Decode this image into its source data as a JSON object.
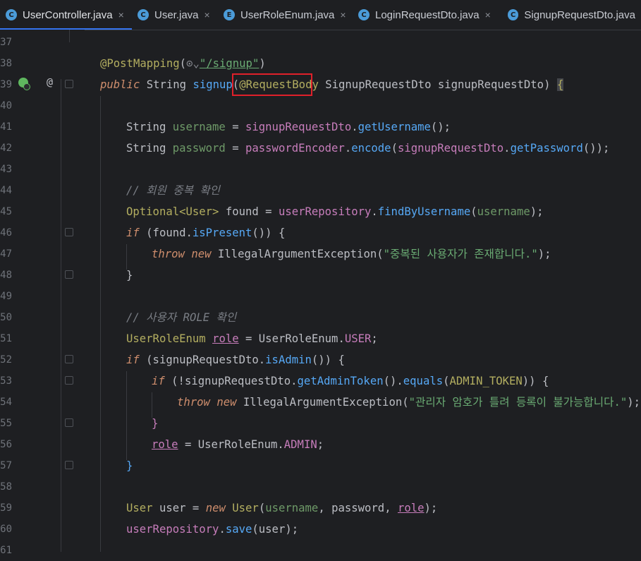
{
  "tabs": [
    {
      "label": "UserController.java",
      "icon": "class-icon",
      "active": true,
      "close": "×"
    },
    {
      "label": "User.java",
      "icon": "class-icon",
      "active": false,
      "close": "×"
    },
    {
      "label": "UserRoleEnum.java",
      "icon": "enum-icon",
      "active": false,
      "close": "×"
    },
    {
      "label": "LoginRequestDto.java",
      "icon": "class-icon",
      "active": false,
      "close": "×"
    },
    {
      "label": "SignupRequestDto.java",
      "icon": "class-icon",
      "active": false,
      "close": ""
    }
  ],
  "tab_icon_letters": {
    "class": "C",
    "enum": "E"
  },
  "line_numbers": [
    "37",
    "38",
    "39",
    "40",
    "41",
    "42",
    "43",
    "44",
    "45",
    "46",
    "47",
    "48",
    "49",
    "50",
    "51",
    "52",
    "53",
    "54",
    "55",
    "56",
    "57",
    "58",
    "59",
    "60",
    "61"
  ],
  "code": {
    "l38": {
      "a1": "@PostMapping",
      "a2": "(",
      "a3": "⊙⌄",
      "a4": "\"/signup\"",
      "a5": ")"
    },
    "l39": {
      "t1": "public",
      "t2": " String ",
      "t3": "signup",
      "t4": "(",
      "t5": "@RequestBody",
      "t6": " SignupRequestDto ",
      "t7": "signupRequestDto",
      "t8": ") ",
      "t9": "{"
    },
    "l41": {
      "t1": "String ",
      "t2": "username",
      "t3": " = ",
      "t4": "signupRequestDto",
      "t5": ".",
      "t6": "getUsername",
      "t7": "();"
    },
    "l42": {
      "t1": "String ",
      "t2": "password",
      "t3": " = ",
      "t4": "passwordEncoder",
      "t5": ".",
      "t6": "encode",
      "t7": "(",
      "t8": "signupRequestDto",
      "t9": ".",
      "t10": "getPassword",
      "t11": "());"
    },
    "l44": {
      "t1": "// 회원 중복 확인"
    },
    "l45": {
      "t1": "Optional<User> ",
      "t2": "found",
      "t3": " = ",
      "t4": "userRepository",
      "t5": ".",
      "t6": "findByUsername",
      "t7": "(",
      "t8": "username",
      "t9": ");"
    },
    "l46": {
      "t1": "if",
      "t2": " (found.",
      "t3": "isPresent",
      "t4": "()) {"
    },
    "l47": {
      "t1": "throw",
      "t2": " ",
      "t3": "new",
      "t4": " IllegalArgumentException",
      "t5": "(",
      "t6": "\"중복된 사용자가 존재합니다.\"",
      "t7": ");"
    },
    "l48": {
      "t1": "}"
    },
    "l50": {
      "t1": "// 사용자 ROLE 확인"
    },
    "l51": {
      "t1": "UserRoleEnum ",
      "t2": "role",
      "t3": " = UserRoleEnum.",
      "t4": "USER",
      "t5": ";"
    },
    "l52": {
      "t1": "if",
      "t2": " (signupRequestDto.",
      "t3": "isAdmin",
      "t4": "()) {"
    },
    "l53": {
      "t1": "if",
      "t2": " (!signupRequestDto.",
      "t3": "getAdminToken",
      "t4": "().",
      "t5": "equals",
      "t6": "(",
      "t7": "ADMIN_TOKEN",
      "t8": ")) {"
    },
    "l54": {
      "t1": "throw",
      "t2": " ",
      "t3": "new",
      "t4": " IllegalArgumentException",
      "t5": "(",
      "t6": "\"관리자 암호가 틀려 등록이 불가능합니다.\"",
      "t7": ");"
    },
    "l55": {
      "t1": "}"
    },
    "l56": {
      "t1": "role",
      "t2": " = UserRoleEnum.",
      "t3": "ADMIN",
      "t4": ";"
    },
    "l57": {
      "t1": "}"
    },
    "l59": {
      "t1": "User ",
      "t2": "user",
      "t3": " = ",
      "t4": "new",
      "t5": " User",
      "t6": "(",
      "t7": "username",
      "t8": ", ",
      "t9": "password",
      "t10": ", ",
      "t11": "role",
      "t12": ");"
    },
    "l60": {
      "t1": "userRepository",
      "t2": ".",
      "t3": "save",
      "t4": "(user);"
    }
  },
  "gutter_icons": {
    "at_symbol": "@"
  },
  "colors": {
    "background": "#1e1f22",
    "keyword": "#cf8e6d",
    "string": "#6aab73",
    "comment": "#7a7e85",
    "annotation": "#b3ae60",
    "method": "#56a8f5",
    "field": "#c77dbb",
    "highlight_box": "#e0202a",
    "tab_underline": "#3574f0"
  }
}
